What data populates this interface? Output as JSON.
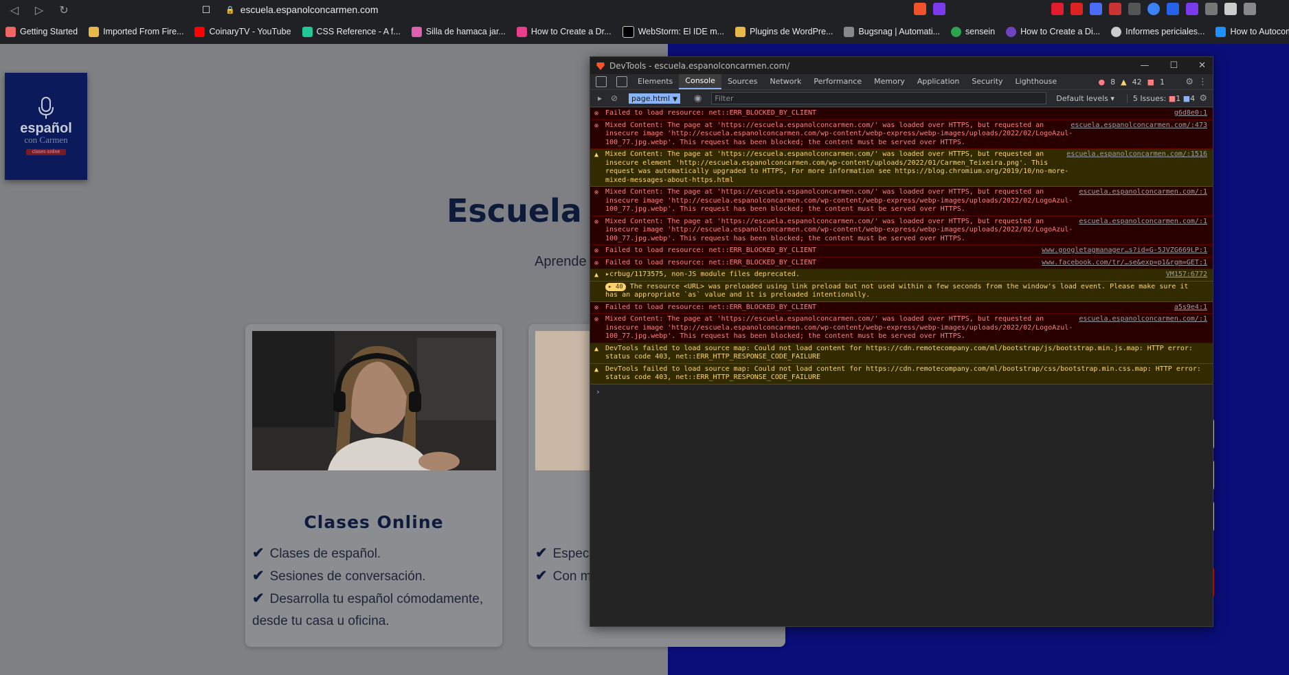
{
  "browser": {
    "url": "escuela.espanolconcarmen.com",
    "bookmarks": [
      {
        "label": "Getting Started",
        "color": "#e66"
      },
      {
        "label": "Imported From Fire...",
        "color": "#e8b84a"
      },
      {
        "label": "CoinaryTV - YouTube",
        "color": "#ff0000"
      },
      {
        "label": "CSS Reference - A f...",
        "color": "#20c997"
      },
      {
        "label": "Silla de hamaca jar...",
        "color": "#e060b0"
      },
      {
        "label": "How to Create a Dr...",
        "color": "#e83e8c"
      },
      {
        "label": "WebStorm: El IDE m...",
        "color": "#000000"
      },
      {
        "label": "Plugins de WordPre...",
        "color": "#e8b84a"
      },
      {
        "label": "Bugsnag | Automati...",
        "color": "#888888"
      },
      {
        "label": "sensein",
        "color": "#2ea44f"
      },
      {
        "label": "How to Create a Di...",
        "color": "#6f42c1"
      },
      {
        "label": "Informes periciales...",
        "color": "#cccccc"
      },
      {
        "label": "How to Autocompl...",
        "color": "#1e90ff"
      }
    ]
  },
  "site": {
    "logo": {
      "line1": "español",
      "line2": "con Carmen",
      "line3": "clases online"
    },
    "hero_title": "Escuela Es",
    "hero_sub": "Aprende",
    "card1": {
      "title": "Clases Online",
      "items": [
        "Clases de español.",
        "Sesiones de conversación.",
        "Desarrolla tu español cómodamente,"
      ],
      "tail": "desde tu casa u oficina."
    },
    "card2": {
      "items": [
        "Espec",
        "Con m"
      ]
    }
  },
  "devtools": {
    "title": "DevTools - escuela.espanolconcarmen.com/",
    "tabs": [
      "Elements",
      "Console",
      "Sources",
      "Network",
      "Performance",
      "Memory",
      "Application",
      "Security",
      "Lighthouse"
    ],
    "active_tab": "Console",
    "counts": {
      "errors": "8",
      "warnings": "42",
      "issues": "1"
    },
    "toolbar": {
      "context": "page.html",
      "filter_placeholder": "Filter",
      "levels": "Default levels ▾",
      "issues_label": "5 Issues:",
      "issues_err": "1",
      "issues_info": "4"
    },
    "messages": [
      {
        "type": "err",
        "text": "Failed to load resource: net::ERR_BLOCKED_BY_CLIENT",
        "src": "g6d8e0:1"
      },
      {
        "type": "err",
        "text": "Mixed Content: The page at 'https://escuela.espanolconcarmen.com/' was loaded over HTTPS, but requested an insecure image 'http://escuela.espanolconcarmen.com/wp-content/webp-express/webp-images/uploads/2022/02/LogoAzul-100_77.jpg.webp'. This request has been blocked; the content must be served over HTTPS.",
        "src": "escuela.espanolconcarmen.com/:473"
      },
      {
        "type": "warn",
        "text": "Mixed Content: The page at 'https://escuela.espanolconcarmen.com/' was loaded over HTTPS, but requested an insecure element 'http://escuela.espanolconcarmen.com/wp-content/uploads/2022/01/Carmen_Teixeira.png'. This request was automatically upgraded to HTTPS, For more information see https://blog.chromium.org/2019/10/no-more-mixed-messages-about-https.html",
        "src": "escuela.espanolconcarmen.com/:1516"
      },
      {
        "type": "err",
        "text": "Mixed Content: The page at 'https://escuela.espanolconcarmen.com/' was loaded over HTTPS, but requested an insecure image 'http://escuela.espanolconcarmen.com/wp-content/webp-express/webp-images/uploads/2022/02/LogoAzul-100_77.jpg.webp'. This request has been blocked; the content must be served over HTTPS.",
        "src": "escuela.espanolconcarmen.com/:1"
      },
      {
        "type": "err",
        "text": "Mixed Content: The page at 'https://escuela.espanolconcarmen.com/' was loaded over HTTPS, but requested an insecure image 'http://escuela.espanolconcarmen.com/wp-content/webp-express/webp-images/uploads/2022/02/LogoAzul-100_77.jpg.webp'. This request has been blocked; the content must be served over HTTPS.",
        "src": "escuela.espanolconcarmen.com/:1"
      },
      {
        "type": "err",
        "text": "Failed to load resource: net::ERR_BLOCKED_BY_CLIENT",
        "src": "www.googletagmanager…s?id=G-5JVZG669LP:1"
      },
      {
        "type": "err",
        "text": "Failed to load resource: net::ERR_BLOCKED_BY_CLIENT",
        "src": "www.facebook.com/tr/…se&exp=p1&rgm=GET:1"
      },
      {
        "type": "warn",
        "text": "▸crbug/1173575, non-JS module files deprecated.",
        "src": "VM157:6772"
      },
      {
        "type": "warn",
        "badge": "▸ 40",
        "text": "The resource <URL> was preloaded using link preload but not used within a few seconds from the window's load event. Please make sure it has an appropriate `as` value and it is preloaded intentionally.",
        "src": ""
      },
      {
        "type": "err",
        "text": "Failed to load resource: net::ERR_BLOCKED_BY_CLIENT",
        "src": "a5s9e4:1"
      },
      {
        "type": "err",
        "text": "Mixed Content: The page at 'https://escuela.espanolconcarmen.com/' was loaded over HTTPS, but requested an insecure image 'http://escuela.espanolconcarmen.com/wp-content/webp-express/webp-images/uploads/2022/02/LogoAzul-100_77.jpg.webp'. This request has been blocked; the content must be served over HTTPS.",
        "src": "escuela.espanolconcarmen.com/:1"
      },
      {
        "type": "warn",
        "text": "DevTools failed to load source map: Could not load content for https://cdn.remotecompany.com/ml/bootstrap/js/bootstrap.min.js.map: HTTP error: status code 403, net::ERR_HTTP_RESPONSE_CODE_FAILURE",
        "src": ""
      },
      {
        "type": "warn",
        "text": "DevTools failed to load source map: Could not load content for https://cdn.remotecompany.com/ml/bootstrap/css/bootstrap.min.css.map: HTTP error: status code 403, net::ERR_HTTP_RESPONSE_CODE_FAILURE",
        "src": ""
      }
    ],
    "prompt": "›"
  }
}
